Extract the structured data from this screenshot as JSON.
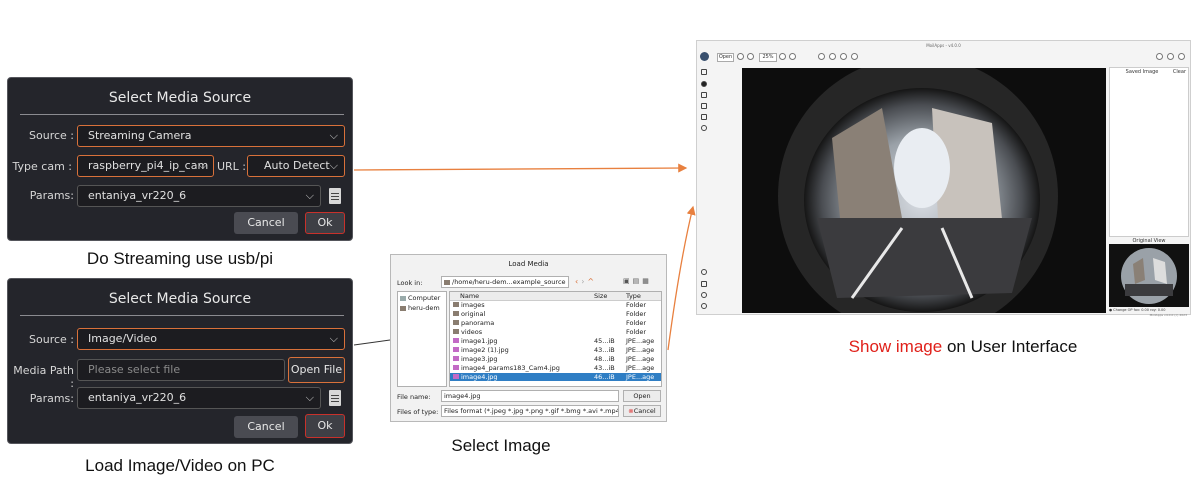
{
  "dialog_stream": {
    "title": "Select Media Source",
    "source_label": "Source :",
    "source_value": "Streaming Camera",
    "typecam_label": "Type cam :",
    "typecam_value": "raspberry_pi4_ip_cam",
    "url_label": "URL :",
    "url_value": "Auto Detect",
    "params_label": "Params:",
    "params_value": "entaniya_vr220_6",
    "cancel_label": "Cancel",
    "ok_label": "Ok"
  },
  "dialog_image": {
    "title": "Select Media Source",
    "source_label": "Source :",
    "source_value": "Image/Video",
    "mediapath_label": "Media Path :",
    "mediapath_placeholder": "Please select file",
    "openfile_label": "Open File",
    "params_label": "Params:",
    "params_value": "entaniya_vr220_6",
    "cancel_label": "Cancel",
    "ok_label": "Ok"
  },
  "captions": {
    "streaming": "Do Streaming use usb/pi",
    "load": "Load Image/Video on PC",
    "select": "Select Image",
    "show_highlight": "Show image",
    "show_rest": " on User Interface"
  },
  "load_media": {
    "title": "Load Media",
    "lookin_label": "Look in:",
    "lookin_value": "/home/heru-dem...example_source",
    "places": [
      "Computer",
      "heru-dem"
    ],
    "columns": [
      "Name",
      "Size",
      "Type"
    ],
    "files": [
      {
        "name": "images",
        "size": "",
        "type": "Folder",
        "kind": "folder"
      },
      {
        "name": "original",
        "size": "",
        "type": "Folder",
        "kind": "folder"
      },
      {
        "name": "panorama",
        "size": "",
        "type": "Folder",
        "kind": "folder"
      },
      {
        "name": "videos",
        "size": "",
        "type": "Folder",
        "kind": "folder"
      },
      {
        "name": "image1.jpg",
        "size": "45...iB",
        "type": "JPE...age",
        "kind": "image"
      },
      {
        "name": "image2 (1).jpg",
        "size": "43...iB",
        "type": "JPE...age",
        "kind": "image"
      },
      {
        "name": "image3.jpg",
        "size": "48...iB",
        "type": "JPE...age",
        "kind": "image"
      },
      {
        "name": "image4_params183_Cam4.jpg",
        "size": "43...iB",
        "type": "JPE...age",
        "kind": "image"
      },
      {
        "name": "image4.jpg",
        "size": "46...iB",
        "type": "JPE...age",
        "kind": "image",
        "selected": true
      }
    ],
    "filename_label": "File name:",
    "filename_value": "image4.jpg",
    "filetype_label": "Files of type:",
    "filetype_value": "Files format (*.jpeg *.jpg *.png *.gif *.bmg *.avi *.mp4)",
    "open_label": "Open",
    "cancel_label": "Cancel"
  },
  "app": {
    "title": "MoilApps - v4.0.0",
    "open_label": "Open",
    "zoom_value": "25%",
    "saved_image_label": "Saved Image",
    "clear_label": "Clear",
    "original_view_label": "Original View",
    "status_text": "● Change OP   fov: 0.00   roy: 0.00",
    "footer_text": "MoilApps v4.0.0 (c) 2023"
  },
  "colors": {
    "arrow": "#e8803f",
    "highlight_border": "#d9713a",
    "ok_border": "#c8312b",
    "caption_highlight": "#e0201a",
    "dialog_bg": "#24252b"
  }
}
